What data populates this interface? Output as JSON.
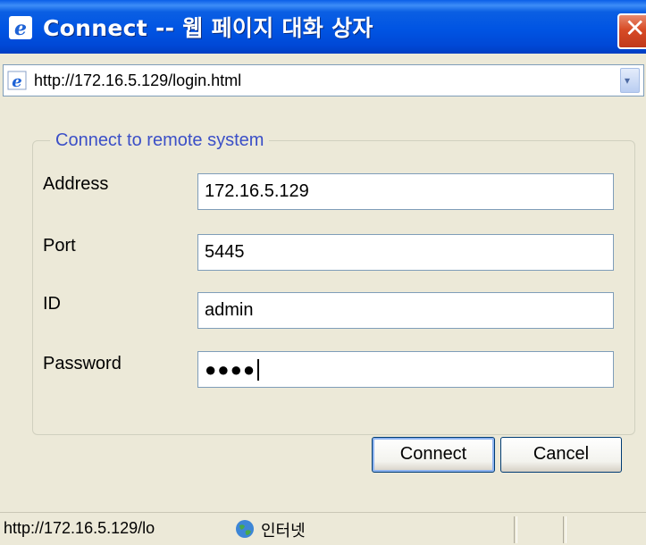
{
  "window": {
    "title": "Connect -- 웹 페이지 대화 상자",
    "close_glyph": "✕",
    "title_icon": "ie-icon"
  },
  "address_bar": {
    "url": "http://172.16.5.129/login.html",
    "icon": "ie-icon",
    "dropdown_glyph": "▾"
  },
  "form": {
    "legend": "Connect to remote system",
    "fields": [
      {
        "label": "Address",
        "value": "172.16.5.129"
      },
      {
        "label": "Port",
        "value": "5445"
      },
      {
        "label": "ID",
        "value": "admin"
      },
      {
        "label": "Password",
        "value": "●●●●"
      }
    ],
    "connect_label": "Connect",
    "cancel_label": "Cancel"
  },
  "status_bar": {
    "url": "http://172.16.5.129/lo",
    "zone": "인터넷",
    "zone_icon": "globe-icon"
  },
  "colors": {
    "titlebar": "#0054e3",
    "legend": "#3b4fc7",
    "close": "#d74b26"
  }
}
